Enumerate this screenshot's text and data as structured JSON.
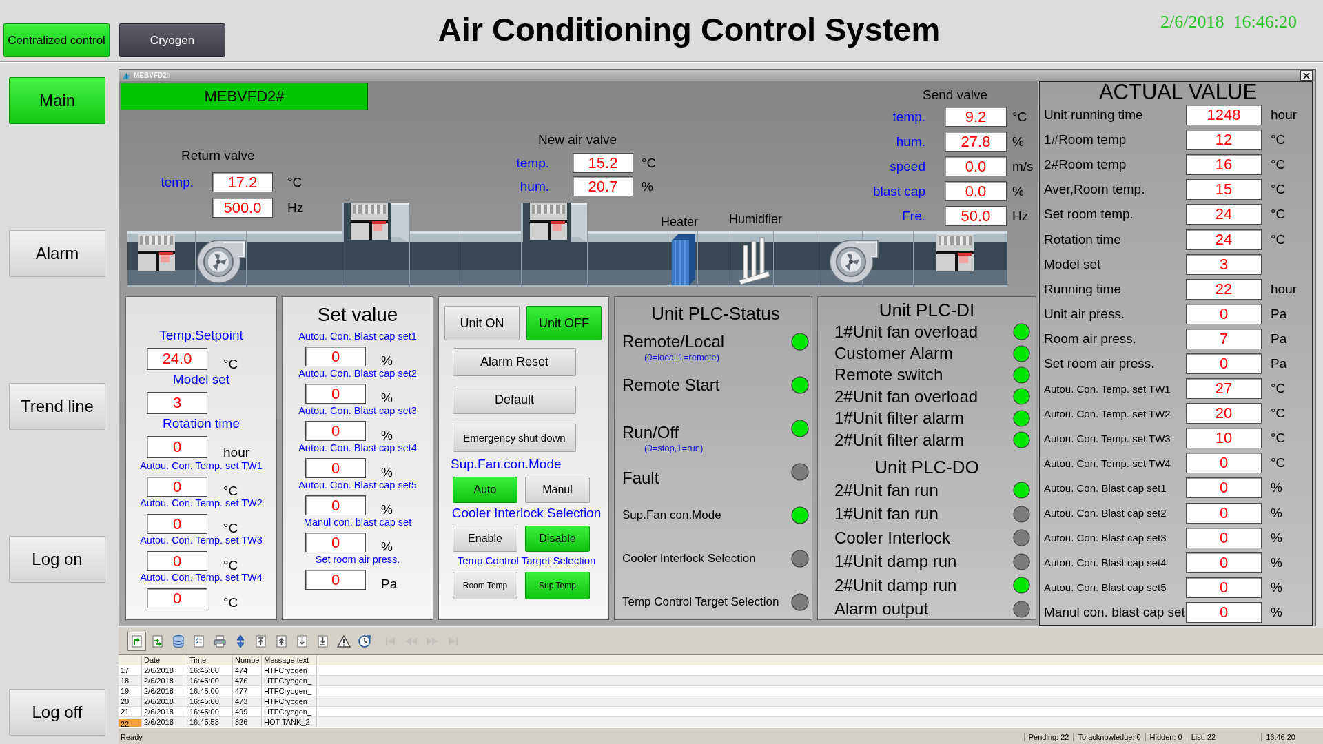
{
  "header": {
    "nav": [
      {
        "label": "Centralized control",
        "selected": true
      },
      {
        "label": "Cryogen",
        "selected": false
      }
    ],
    "title": "Air Conditioning Control System",
    "datetime": "2/6/2018  16:46:20"
  },
  "sidebar": {
    "items": [
      {
        "label": "Main",
        "selected": true
      },
      {
        "label": "Alarm",
        "selected": false
      },
      {
        "label": "Trend line",
        "selected": false
      },
      {
        "label": "Log on",
        "selected": false
      },
      {
        "label": "Log off",
        "selected": false
      }
    ]
  },
  "window": {
    "title": "MEBVFD2#",
    "unit_name": "MEBVFD2#"
  },
  "diagram": {
    "valves": [
      {
        "title": "Return valve",
        "readings": [
          {
            "label": "temp.",
            "value": "17.2",
            "unit": "°C"
          },
          {
            "value": "500.0",
            "unit": "Hz"
          }
        ]
      },
      {
        "title": "New air valve",
        "readings": [
          {
            "label": "temp.",
            "value": "15.2",
            "unit": "°C"
          },
          {
            "label": "hum.",
            "value": "20.7",
            "unit": "%"
          }
        ]
      },
      {
        "title": "Send valve",
        "readings": [
          {
            "label": "temp.",
            "value": "9.2",
            "unit": "°C"
          },
          {
            "label": "hum.",
            "value": "27.8",
            "unit": "%"
          },
          {
            "label": "speed",
            "value": "0.0",
            "unit": "m/s"
          },
          {
            "label": "blast cap",
            "value": "0.0",
            "unit": "%"
          },
          {
            "label": "Fre.",
            "value": "50.0",
            "unit": "Hz"
          }
        ]
      }
    ],
    "components": [
      {
        "kind": "damper"
      },
      {
        "kind": "fan"
      },
      {
        "kind": "damper"
      },
      {
        "kind": "damper"
      },
      {
        "kind": "heater",
        "label": "Heater"
      },
      {
        "kind": "humidifier",
        "label": "Humidfier"
      },
      {
        "kind": "fan"
      },
      {
        "kind": "damper"
      }
    ]
  },
  "setpoints": {
    "items": [
      {
        "label": "Temp.Setpoint",
        "value": "24.0",
        "unit": "°C"
      },
      {
        "label": "Model set",
        "value": "3"
      },
      {
        "label": "Rotation time",
        "value": "0",
        "unit": "hour"
      },
      {
        "label": "Autou. Con. Temp. set TW1",
        "value": "0",
        "unit": "°C"
      },
      {
        "label": "Autou. Con. Temp. set TW2",
        "value": "0",
        "unit": "°C"
      },
      {
        "label": "Autou. Con. Temp. set TW3",
        "value": "0",
        "unit": "°C"
      },
      {
        "label": "Autou. Con. Temp. set TW4",
        "value": "0",
        "unit": "°C"
      }
    ]
  },
  "set_value": {
    "title": "Set value",
    "items": [
      {
        "label": "Autou. Con. Blast cap set1",
        "value": "0",
        "unit": "%"
      },
      {
        "label": "Autou. Con. Blast cap set2",
        "value": "0",
        "unit": "%"
      },
      {
        "label": "Autou. Con. Blast cap set3",
        "value": "0",
        "unit": "%"
      },
      {
        "label": "Autou. Con. Blast cap set4",
        "value": "0",
        "unit": "%"
      },
      {
        "label": "Autou. Con. Blast cap set5",
        "value": "0",
        "unit": "%"
      },
      {
        "label": "Manul con. blast cap set",
        "value": "0",
        "unit": "%"
      },
      {
        "label": "Set room air press.",
        "value": "0",
        "unit": "Pa"
      }
    ]
  },
  "controls": {
    "unit_buttons": [
      {
        "label": "Unit ON",
        "selected": false
      },
      {
        "label": "Unit OFF",
        "selected": true
      }
    ],
    "actions": [
      "Alarm Reset",
      "Default",
      "Emergency shut down"
    ],
    "selectors": [
      {
        "title": "Sup.Fan.con.Mode",
        "options": [
          {
            "label": "Auto",
            "selected": true
          },
          {
            "label": "Manul",
            "selected": false
          }
        ]
      },
      {
        "title": "Cooler Interlock Selection",
        "options": [
          {
            "label": "Enable",
            "selected": false
          },
          {
            "label": "Disable",
            "selected": true
          }
        ]
      },
      {
        "title": "Temp Control Target Selection",
        "options": [
          {
            "label": "Room Temp",
            "selected": false
          },
          {
            "label": "Sup Temp",
            "selected": true
          }
        ]
      }
    ]
  },
  "plc_status": {
    "title": "Unit PLC-Status",
    "items": [
      {
        "label": "Remote/Local",
        "note": "(0=local.1=remote)",
        "on": true
      },
      {
        "label": "Remote Start",
        "on": true
      },
      {
        "label": "Run/Off",
        "note": "(0=stop,1=run)",
        "on": true
      },
      {
        "label": "Fault",
        "on": false
      },
      {
        "label": "Sup.Fan con.Mode",
        "on": true
      },
      {
        "label": "Cooler Interlock Selection",
        "on": false
      },
      {
        "label": "Temp Control Target Selection",
        "on": false
      }
    ]
  },
  "plc_di": {
    "title": "Unit PLC-DI",
    "items": [
      {
        "label": "1#Unit fan overload",
        "on": true
      },
      {
        "label": "Customer Alarm",
        "on": true
      },
      {
        "label": "Remote switch",
        "on": true
      },
      {
        "label": "2#Unit fan overload",
        "on": true
      },
      {
        "label": "1#Unit filter alarm",
        "on": true
      },
      {
        "label": "2#Unit filter alarm",
        "on": true
      }
    ]
  },
  "plc_do": {
    "title": "Unit PLC-DO",
    "items": [
      {
        "label": "2#Unit fan run",
        "on": true
      },
      {
        "label": "1#Unit fan run",
        "on": false
      },
      {
        "label": "Cooler Interlock",
        "on": false
      },
      {
        "label": "1#Unit damp run",
        "on": false
      },
      {
        "label": "2#Unit damp run",
        "on": true
      },
      {
        "label": "Alarm output",
        "on": false
      }
    ]
  },
  "actual_value": {
    "title": "ACTUAL VALUE",
    "rows": [
      {
        "label": "Unit running time",
        "value": "1248",
        "unit": "hour"
      },
      {
        "label": "1#Room temp",
        "value": "12",
        "unit": "°C"
      },
      {
        "label": "2#Room temp",
        "value": "16",
        "unit": "°C"
      },
      {
        "label": "Aver,Room temp.",
        "value": "15",
        "unit": "°C"
      },
      {
        "label": "Set room temp.",
        "value": "24",
        "unit": "°C"
      },
      {
        "label": "Rotation time",
        "value": "24",
        "unit": "°C"
      },
      {
        "label": "Model set",
        "value": "3"
      },
      {
        "label": "Running time",
        "value": "22",
        "unit": "hour"
      },
      {
        "label": "Unit air press.",
        "value": "0",
        "unit": "Pa"
      },
      {
        "label": "Room air press.",
        "value": "7",
        "unit": "Pa"
      },
      {
        "label": "Set room air press.",
        "value": "0",
        "unit": "Pa"
      },
      {
        "label": "Autou. Con. Temp. set TW1",
        "value": "27",
        "unit": "°C"
      },
      {
        "label": "Autou. Con. Temp. set TW2",
        "value": "20",
        "unit": "°C"
      },
      {
        "label": "Autou. Con. Temp. set TW3",
        "value": "10",
        "unit": "°C"
      },
      {
        "label": "Autou. Con. Temp. set TW4",
        "value": "0",
        "unit": "°C"
      },
      {
        "label": "Autou. Con. Blast cap set1",
        "value": "0",
        "unit": "%"
      },
      {
        "label": "Autou. Con. Blast cap set2",
        "value": "0",
        "unit": "%"
      },
      {
        "label": "Autou. Con. Blast cap set3",
        "value": "0",
        "unit": "%"
      },
      {
        "label": "Autou. Con. Blast cap set4",
        "value": "0",
        "unit": "%"
      },
      {
        "label": "Autou. Con. Blast cap set5",
        "value": "0",
        "unit": "%"
      },
      {
        "label": "Manul con. blast cap set",
        "value": "0",
        "unit": "%"
      }
    ]
  },
  "alarm_log": {
    "toolbar": [
      {
        "kind": "arrowpage",
        "selected": true,
        "disabled": false
      },
      {
        "kind": "arrowspage",
        "selected": false,
        "disabled": false
      },
      {
        "kind": "database",
        "selected": false,
        "disabled": false
      },
      {
        "kind": "checklist",
        "selected": false,
        "disabled": false
      },
      {
        "kind": "printer",
        "selected": false,
        "disabled": false
      },
      {
        "kind": "updown",
        "selected": false,
        "disabled": false
      },
      {
        "kind": "top",
        "selected": false,
        "disabled": false
      },
      {
        "kind": "up",
        "selected": false,
        "disabled": false
      },
      {
        "kind": "down",
        "selected": false,
        "disabled": false
      },
      {
        "kind": "bottom",
        "selected": false,
        "disabled": false
      },
      {
        "kind": "warning",
        "selected": false,
        "disabled": false
      },
      {
        "kind": "clock",
        "selected": false,
        "disabled": false
      },
      {
        "kind": "first",
        "selected": false,
        "disabled": true
      },
      {
        "kind": "previous",
        "selected": false,
        "disabled": true
      },
      {
        "kind": "next",
        "selected": false,
        "disabled": true
      },
      {
        "kind": "last",
        "selected": false,
        "disabled": true
      }
    ],
    "columns": [
      "Date",
      "Time",
      "Numbe",
      "Message text"
    ],
    "rows": [
      {
        "index": "17",
        "cells": [
          "2/6/2018",
          "16:45:00",
          "474",
          "HTFCryogen_"
        ],
        "selected": false
      },
      {
        "index": "18",
        "cells": [
          "2/6/2018",
          "16:45:00",
          "476",
          "HTFCryogen_"
        ],
        "selected": false
      },
      {
        "index": "19",
        "cells": [
          "2/6/2018",
          "16:45:00",
          "477",
          "HTFCryogen_"
        ],
        "selected": false
      },
      {
        "index": "20",
        "cells": [
          "2/6/2018",
          "16:45:00",
          "473",
          "HTFCryogen_"
        ],
        "selected": false
      },
      {
        "index": "21",
        "cells": [
          "2/6/2018",
          "16:45:00",
          "499",
          "HTFCryogen_"
        ],
        "selected": false
      },
      {
        "index": "22",
        "cells": [
          "2/6/2018",
          "16:45:58",
          "826",
          "HOT TANK_2"
        ],
        "selected": true
      }
    ]
  },
  "status_bar": {
    "message": "Ready",
    "fields": [
      "Pending: 22",
      "To acknowledge: 0",
      "Hidden: 0",
      "List: 22",
      "16:46:20"
    ]
  }
}
